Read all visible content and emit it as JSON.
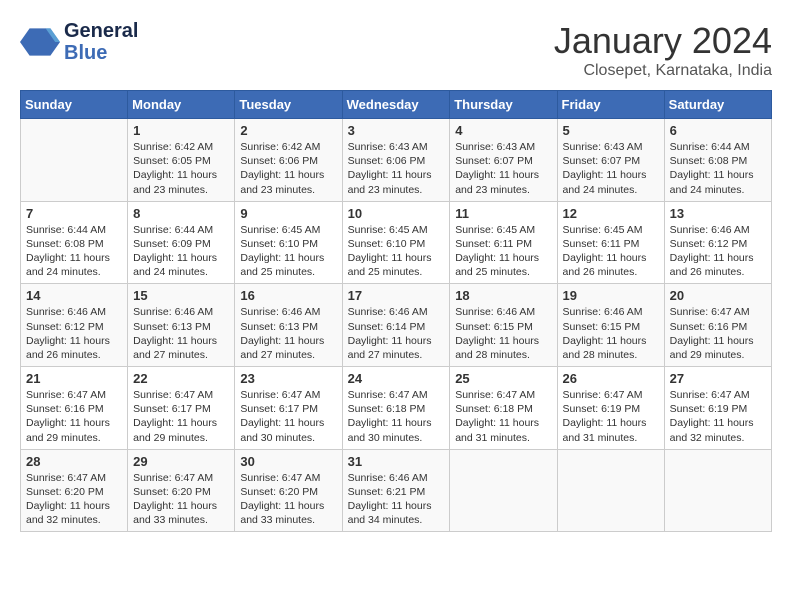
{
  "app": {
    "logo_line1": "General",
    "logo_line2": "Blue"
  },
  "header": {
    "month_year": "January 2024",
    "location": "Closepet, Karnataka, India"
  },
  "weekdays": [
    "Sunday",
    "Monday",
    "Tuesday",
    "Wednesday",
    "Thursday",
    "Friday",
    "Saturday"
  ],
  "weeks": [
    [
      {
        "day": "",
        "sunrise": "",
        "sunset": "",
        "daylight": ""
      },
      {
        "day": "1",
        "sunrise": "Sunrise: 6:42 AM",
        "sunset": "Sunset: 6:05 PM",
        "daylight": "Daylight: 11 hours and 23 minutes."
      },
      {
        "day": "2",
        "sunrise": "Sunrise: 6:42 AM",
        "sunset": "Sunset: 6:06 PM",
        "daylight": "Daylight: 11 hours and 23 minutes."
      },
      {
        "day": "3",
        "sunrise": "Sunrise: 6:43 AM",
        "sunset": "Sunset: 6:06 PM",
        "daylight": "Daylight: 11 hours and 23 minutes."
      },
      {
        "day": "4",
        "sunrise": "Sunrise: 6:43 AM",
        "sunset": "Sunset: 6:07 PM",
        "daylight": "Daylight: 11 hours and 23 minutes."
      },
      {
        "day": "5",
        "sunrise": "Sunrise: 6:43 AM",
        "sunset": "Sunset: 6:07 PM",
        "daylight": "Daylight: 11 hours and 24 minutes."
      },
      {
        "day": "6",
        "sunrise": "Sunrise: 6:44 AM",
        "sunset": "Sunset: 6:08 PM",
        "daylight": "Daylight: 11 hours and 24 minutes."
      }
    ],
    [
      {
        "day": "7",
        "sunrise": "Sunrise: 6:44 AM",
        "sunset": "Sunset: 6:08 PM",
        "daylight": "Daylight: 11 hours and 24 minutes."
      },
      {
        "day": "8",
        "sunrise": "Sunrise: 6:44 AM",
        "sunset": "Sunset: 6:09 PM",
        "daylight": "Daylight: 11 hours and 24 minutes."
      },
      {
        "day": "9",
        "sunrise": "Sunrise: 6:45 AM",
        "sunset": "Sunset: 6:10 PM",
        "daylight": "Daylight: 11 hours and 25 minutes."
      },
      {
        "day": "10",
        "sunrise": "Sunrise: 6:45 AM",
        "sunset": "Sunset: 6:10 PM",
        "daylight": "Daylight: 11 hours and 25 minutes."
      },
      {
        "day": "11",
        "sunrise": "Sunrise: 6:45 AM",
        "sunset": "Sunset: 6:11 PM",
        "daylight": "Daylight: 11 hours and 25 minutes."
      },
      {
        "day": "12",
        "sunrise": "Sunrise: 6:45 AM",
        "sunset": "Sunset: 6:11 PM",
        "daylight": "Daylight: 11 hours and 26 minutes."
      },
      {
        "day": "13",
        "sunrise": "Sunrise: 6:46 AM",
        "sunset": "Sunset: 6:12 PM",
        "daylight": "Daylight: 11 hours and 26 minutes."
      }
    ],
    [
      {
        "day": "14",
        "sunrise": "Sunrise: 6:46 AM",
        "sunset": "Sunset: 6:12 PM",
        "daylight": "Daylight: 11 hours and 26 minutes."
      },
      {
        "day": "15",
        "sunrise": "Sunrise: 6:46 AM",
        "sunset": "Sunset: 6:13 PM",
        "daylight": "Daylight: 11 hours and 27 minutes."
      },
      {
        "day": "16",
        "sunrise": "Sunrise: 6:46 AM",
        "sunset": "Sunset: 6:13 PM",
        "daylight": "Daylight: 11 hours and 27 minutes."
      },
      {
        "day": "17",
        "sunrise": "Sunrise: 6:46 AM",
        "sunset": "Sunset: 6:14 PM",
        "daylight": "Daylight: 11 hours and 27 minutes."
      },
      {
        "day": "18",
        "sunrise": "Sunrise: 6:46 AM",
        "sunset": "Sunset: 6:15 PM",
        "daylight": "Daylight: 11 hours and 28 minutes."
      },
      {
        "day": "19",
        "sunrise": "Sunrise: 6:46 AM",
        "sunset": "Sunset: 6:15 PM",
        "daylight": "Daylight: 11 hours and 28 minutes."
      },
      {
        "day": "20",
        "sunrise": "Sunrise: 6:47 AM",
        "sunset": "Sunset: 6:16 PM",
        "daylight": "Daylight: 11 hours and 29 minutes."
      }
    ],
    [
      {
        "day": "21",
        "sunrise": "Sunrise: 6:47 AM",
        "sunset": "Sunset: 6:16 PM",
        "daylight": "Daylight: 11 hours and 29 minutes."
      },
      {
        "day": "22",
        "sunrise": "Sunrise: 6:47 AM",
        "sunset": "Sunset: 6:17 PM",
        "daylight": "Daylight: 11 hours and 29 minutes."
      },
      {
        "day": "23",
        "sunrise": "Sunrise: 6:47 AM",
        "sunset": "Sunset: 6:17 PM",
        "daylight": "Daylight: 11 hours and 30 minutes."
      },
      {
        "day": "24",
        "sunrise": "Sunrise: 6:47 AM",
        "sunset": "Sunset: 6:18 PM",
        "daylight": "Daylight: 11 hours and 30 minutes."
      },
      {
        "day": "25",
        "sunrise": "Sunrise: 6:47 AM",
        "sunset": "Sunset: 6:18 PM",
        "daylight": "Daylight: 11 hours and 31 minutes."
      },
      {
        "day": "26",
        "sunrise": "Sunrise: 6:47 AM",
        "sunset": "Sunset: 6:19 PM",
        "daylight": "Daylight: 11 hours and 31 minutes."
      },
      {
        "day": "27",
        "sunrise": "Sunrise: 6:47 AM",
        "sunset": "Sunset: 6:19 PM",
        "daylight": "Daylight: 11 hours and 32 minutes."
      }
    ],
    [
      {
        "day": "28",
        "sunrise": "Sunrise: 6:47 AM",
        "sunset": "Sunset: 6:20 PM",
        "daylight": "Daylight: 11 hours and 32 minutes."
      },
      {
        "day": "29",
        "sunrise": "Sunrise: 6:47 AM",
        "sunset": "Sunset: 6:20 PM",
        "daylight": "Daylight: 11 hours and 33 minutes."
      },
      {
        "day": "30",
        "sunrise": "Sunrise: 6:47 AM",
        "sunset": "Sunset: 6:20 PM",
        "daylight": "Daylight: 11 hours and 33 minutes."
      },
      {
        "day": "31",
        "sunrise": "Sunrise: 6:46 AM",
        "sunset": "Sunset: 6:21 PM",
        "daylight": "Daylight: 11 hours and 34 minutes."
      },
      {
        "day": "",
        "sunrise": "",
        "sunset": "",
        "daylight": ""
      },
      {
        "day": "",
        "sunrise": "",
        "sunset": "",
        "daylight": ""
      },
      {
        "day": "",
        "sunrise": "",
        "sunset": "",
        "daylight": ""
      }
    ]
  ]
}
